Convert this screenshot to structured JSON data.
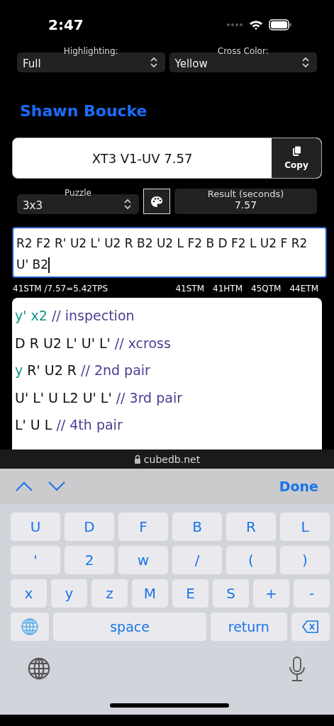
{
  "status_bar": {
    "time": "2:47"
  },
  "selects": [
    {
      "label": "Highlighting:",
      "value": "Full"
    },
    {
      "label": "Cross Color:",
      "value": "Yellow"
    }
  ],
  "solver": "Shawn Boucke",
  "solve_title": "XT3 V1-UV 7.57",
  "copy_button": "Copy",
  "puzzle": {
    "label": "Puzzle",
    "value": "3x3"
  },
  "result": {
    "label": "Result (seconds)",
    "value": "7.57"
  },
  "scramble": "R2 F2 R' U2 L' U2 R B2 U2 L F2 B D F2 L U2 F R2 U' B2",
  "stats": {
    "tps": "41STM /7.57=5.42TPS",
    "metrics": [
      "41STM",
      "41HTM",
      "45QTM",
      "44ETM"
    ]
  },
  "reconstruction": [
    [
      {
        "kind": "rotation",
        "text": "y' x2"
      },
      {
        "kind": "comment",
        "text": "// inspection"
      }
    ],
    [
      {
        "kind": "move",
        "text": "D R U2 L' U' L'"
      },
      {
        "kind": "comment",
        "text": "// xcross"
      }
    ],
    [
      {
        "kind": "rotation",
        "text": "y"
      },
      {
        "kind": "move",
        "text": "R' U2 R"
      },
      {
        "kind": "comment",
        "text": "// 2nd pair"
      }
    ],
    [
      {
        "kind": "move",
        "text": "U' L' U L2 U' L'"
      },
      {
        "kind": "comment",
        "text": "// 3rd pair"
      }
    ],
    [
      {
        "kind": "move",
        "text": "L' U L"
      },
      {
        "kind": "comment",
        "text": "// 4th pair"
      }
    ]
  ],
  "url": "cubedb.net",
  "keyboard_toolbar": {
    "done": "Done"
  },
  "keys": [
    [
      {
        "kind": "key",
        "label": "U"
      },
      {
        "kind": "key",
        "label": "D"
      },
      {
        "kind": "key",
        "label": "F"
      },
      {
        "kind": "key",
        "label": "B"
      },
      {
        "kind": "key",
        "label": "R"
      },
      {
        "kind": "key",
        "label": "L"
      }
    ],
    [
      {
        "kind": "key",
        "label": "'"
      },
      {
        "kind": "key",
        "label": "2"
      },
      {
        "kind": "key",
        "label": "w"
      },
      {
        "kind": "key",
        "label": "/"
      },
      {
        "kind": "key",
        "label": "("
      },
      {
        "kind": "key",
        "label": ")"
      }
    ],
    [
      {
        "kind": "key",
        "label": "x"
      },
      {
        "kind": "key",
        "label": "y"
      },
      {
        "kind": "key",
        "label": "z"
      },
      {
        "kind": "key",
        "label": "M"
      },
      {
        "kind": "key",
        "label": "E"
      },
      {
        "kind": "key",
        "label": "S"
      },
      {
        "kind": "key",
        "label": "+"
      },
      {
        "kind": "key",
        "label": "-"
      }
    ],
    [
      {
        "kind": "globe"
      },
      {
        "kind": "wide",
        "label": "space"
      },
      {
        "kind": "medium",
        "label": "return"
      },
      {
        "kind": "backspace"
      }
    ]
  ]
}
